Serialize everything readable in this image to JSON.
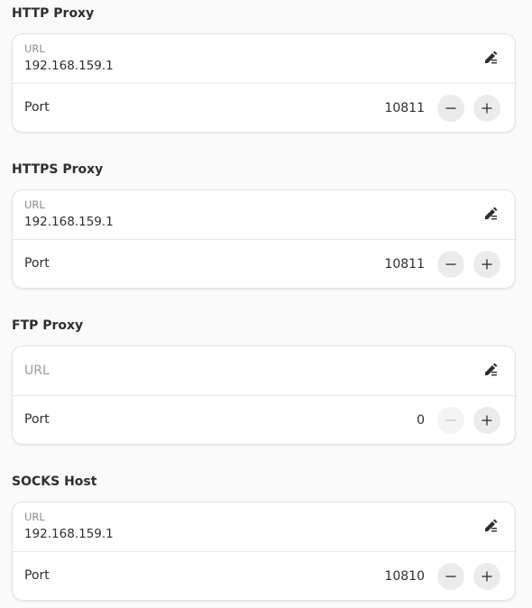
{
  "sections": [
    {
      "title": "HTTP Proxy",
      "url_caption": "URL",
      "url_value": "192.168.159.1",
      "port_label": "Port",
      "port_value": "10811",
      "minus_enabled": true
    },
    {
      "title": "HTTPS Proxy",
      "url_caption": "URL",
      "url_value": "192.168.159.1",
      "port_label": "Port",
      "port_value": "10811",
      "minus_enabled": true
    },
    {
      "title": "FTP Proxy",
      "url_placeholder": "URL",
      "url_value": "",
      "port_label": "Port",
      "port_value": "0",
      "minus_enabled": false
    },
    {
      "title": "SOCKS Host",
      "url_caption": "URL",
      "url_value": "192.168.159.1",
      "port_label": "Port",
      "port_value": "10810",
      "minus_enabled": true
    }
  ],
  "icons": {
    "edit": "edit-icon",
    "minus": "minus-icon",
    "plus": "plus-icon"
  },
  "colors": {
    "background": "#fafafa",
    "card": "#ffffff",
    "button": "#ebebeb",
    "button_disabled": "#f4f4f4"
  }
}
